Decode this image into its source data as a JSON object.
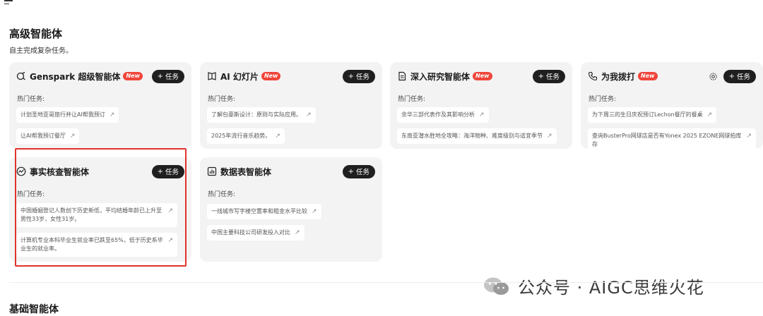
{
  "section": {
    "title": "高级智能体",
    "subtitle": "自主完成复杂任务。"
  },
  "section2": {
    "title": "基础智能体"
  },
  "common": {
    "hot_label": "热门任务:",
    "add_task_label": "任务",
    "new_badge": "New"
  },
  "cards": [
    {
      "title": "Genspark 超级智能体",
      "icon": "super-agent-icon",
      "has_new": true,
      "tasks": [
        "计划圣地亚哥旅行并让AI帮我预订",
        "让AI帮我预订餐厅"
      ]
    },
    {
      "title": "AI 幻灯片",
      "icon": "slides-icon",
      "has_new": true,
      "tasks": [
        "了解包豪斯设计：原则与实际应用。",
        "2025年流行音乐趋势。"
      ]
    },
    {
      "title": "深入研究智能体",
      "icon": "document-icon",
      "has_new": true,
      "tasks": [
        "余华三部代表作及其影响分析",
        "东南亚潜水胜地全攻略：海洋物种、难度级别与适宜季节"
      ]
    },
    {
      "title": "为我拨打",
      "icon": "phone-icon",
      "has_new": true,
      "tasks": [
        "为下周三的生日庆祝预订Lechon餐厅的餐桌",
        "查询BusterPro网球店是否有Yonex 2025 EZONE网球拍库存"
      ]
    },
    {
      "title": "事实核查智能体",
      "icon": "fact-check-icon",
      "has_new": false,
      "tasks": [
        "中国婚姻登记人数创下历史新低，平均结婚年龄已上升至男性33岁，女性31岁。",
        "计算机专业本科毕业生就业率已跌至65%，低于历史系毕业生的就业率。"
      ]
    },
    {
      "title": "数据表智能体",
      "icon": "chart-icon",
      "has_new": false,
      "tasks": [
        "一线城市写字楼空置率和租金水平比较",
        "中国主要科技公司研发投入对比"
      ]
    }
  ],
  "watermark": {
    "text": "公众号 · AIGC思维火花"
  },
  "colors": {
    "card_bg": "#f3f3f3",
    "button_bg": "#1f1f1f",
    "badge_bg": "#f0443a",
    "highlight": "#e0322c"
  }
}
